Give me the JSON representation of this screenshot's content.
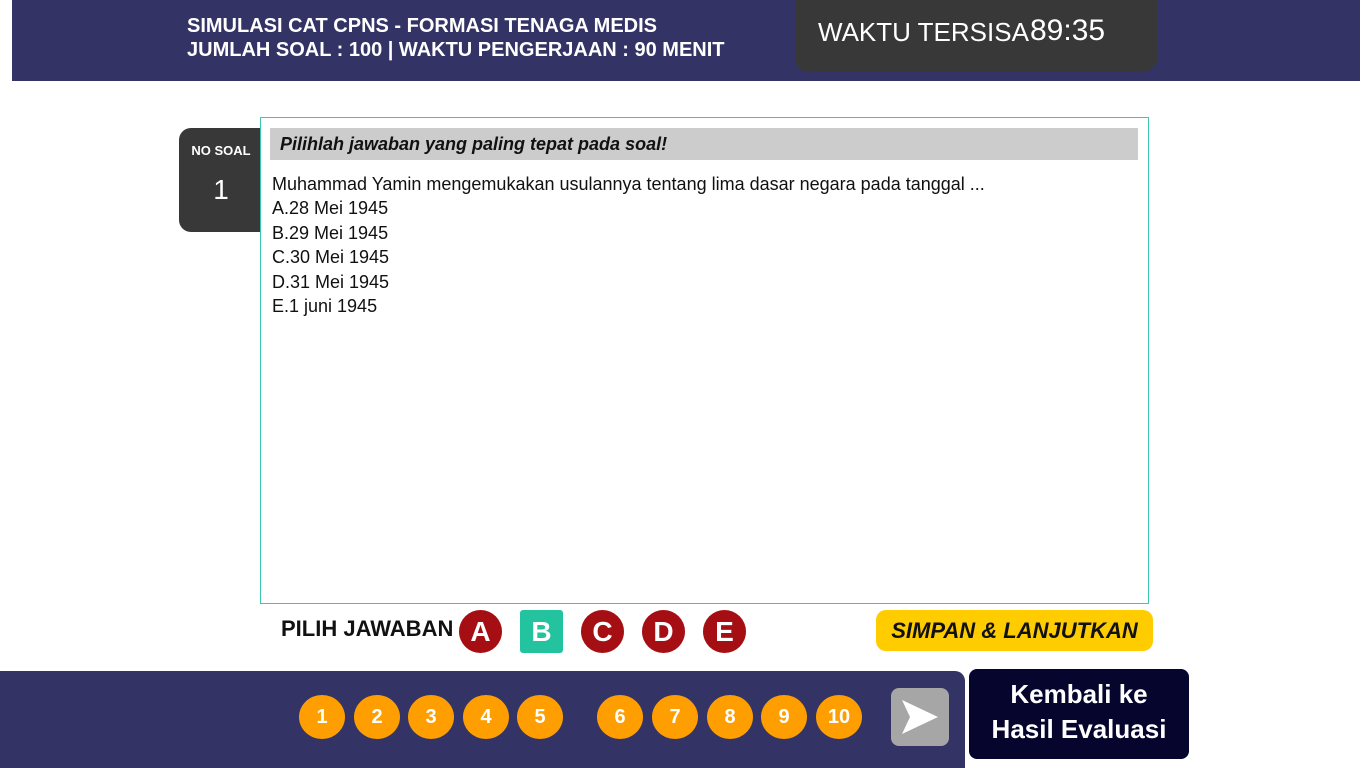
{
  "header": {
    "title_line1": "SIMULASI CAT CPNS - FORMASI TENAGA MEDIS",
    "title_line2": "JUMLAH SOAL : 100 | WAKTU PENGERJAAN : 90 MENIT"
  },
  "timer": {
    "label": "WAKTU TERSISA",
    "value": "89:35"
  },
  "question": {
    "no_label": "NO SOAL",
    "number": "1",
    "instruction": "Pilihlah jawaban yang paling tepat pada soal!",
    "text": "Muhammad Yamin mengemukakan usulannya tentang lima dasar negara pada tanggal ...",
    "options": [
      "A.28 Mei 1945",
      "B.29 Mei 1945",
      "C.30 Mei 1945",
      "D.31 Mei 1945",
      "E.1 juni 1945"
    ]
  },
  "answer": {
    "label": "PILIH JAWABAN",
    "choices": [
      "A",
      "B",
      "C",
      "D",
      "E"
    ],
    "selected": "B",
    "save_label": "SIMPAN & LANJUTKAN"
  },
  "navigation": {
    "numbers": [
      "1",
      "2",
      "3",
      "4",
      "5",
      "6",
      "7",
      "8",
      "9",
      "10"
    ],
    "back_line1": "Kembali ke",
    "back_line2": "Hasil Evaluasi"
  },
  "colors": {
    "header_bg": "#333366",
    "timer_bg": "#383838",
    "answer_red": "#a50f14",
    "answer_selected": "#22c39e",
    "save_yellow": "#ffcc00",
    "number_orange": "#ff9e00",
    "back_button_bg": "#05052d",
    "frame_teal": "#3cc6b4"
  }
}
